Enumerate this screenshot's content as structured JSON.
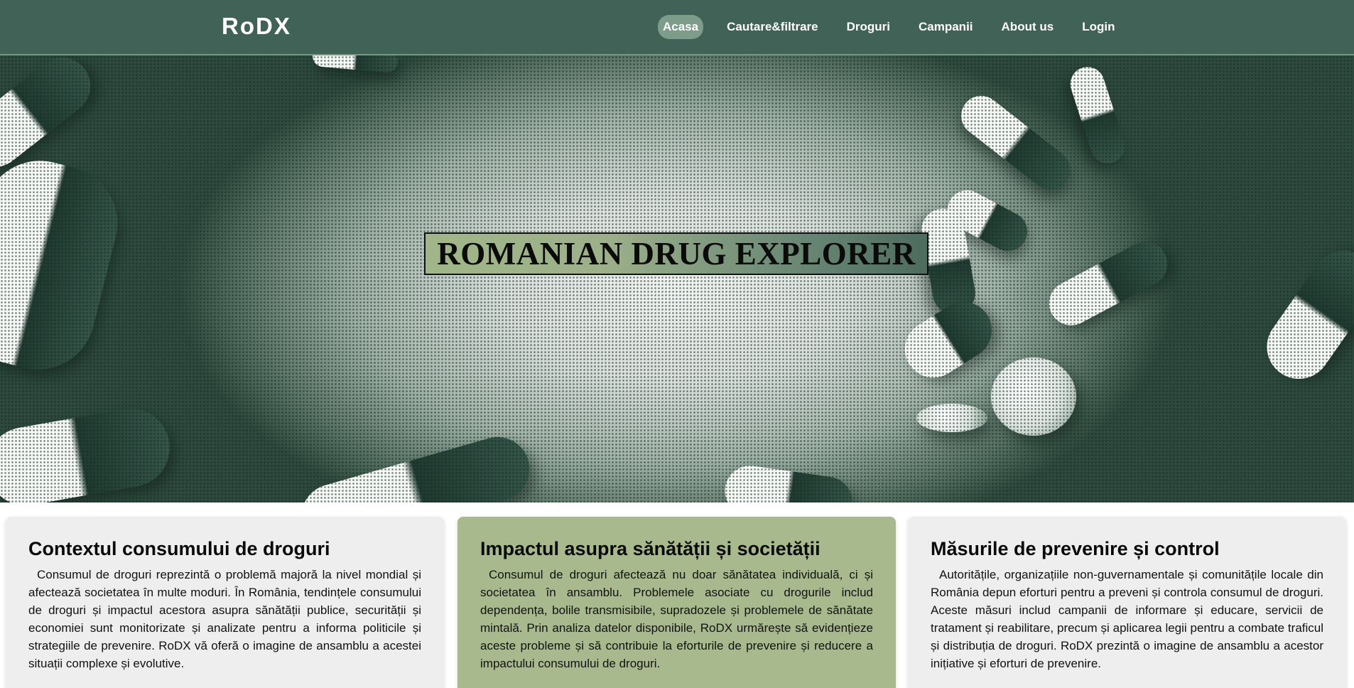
{
  "nav": {
    "logo": "RoDX",
    "links": [
      {
        "label": "Acasa",
        "active": true
      },
      {
        "label": "Cautare&filtrare",
        "active": false
      },
      {
        "label": "Droguri",
        "active": false
      },
      {
        "label": "Campanii",
        "active": false
      },
      {
        "label": "About us",
        "active": false
      },
      {
        "label": "Login",
        "active": false
      }
    ]
  },
  "hero": {
    "title": "ROMANIAN DRUG EXPLORER"
  },
  "cards": [
    {
      "title": "Contextul consumului de droguri",
      "text": "Consumul de droguri reprezintă o problemă majoră la nivel mondial și afectează societatea în multe moduri. În România, tendințele consumului de droguri și impactul acestora asupra sănătății publice, securității și economiei sunt monitorizate și analizate pentru a informa politicile și strategiile de prevenire. RoDX vă oferă o imagine de ansamblu a acestei situații complexe și evolutive."
    },
    {
      "title": "Impactul asupra sănătății și societății",
      "text": "Consumul de droguri afectează nu doar sănătatea individuală, ci și societatea în ansamblu. Problemele asociate cu drogurile includ dependența, bolile transmisibile, supradozele și problemele de sănătate mintală. Prin analiza datelor disponibile, RoDX urmărește să evidențieze aceste probleme și să contribuie la eforturile de prevenire și reducere a impactului consumului de droguri."
    },
    {
      "title": "Măsurile de prevenire și control",
      "text": "Autoritățile, organizațiile non-guvernamentale și comunitățile locale din România depun eforturi pentru a preveni și controla consumul de droguri. Aceste măsuri includ campanii de informare și educare, servicii de tratament și reabilitare, precum și aplicarea legii pentru a combate traficul și distribuția de droguri. RoDX prezintă o imagine de ansamblu a acestor inițiative și eforturi de prevenire."
    }
  ],
  "colors": {
    "nav_bg": "#416256",
    "nav_active_bg": "#7d9c89",
    "card_bg": "#eeeeee",
    "card_highlight_bg": "#a8b98e"
  }
}
